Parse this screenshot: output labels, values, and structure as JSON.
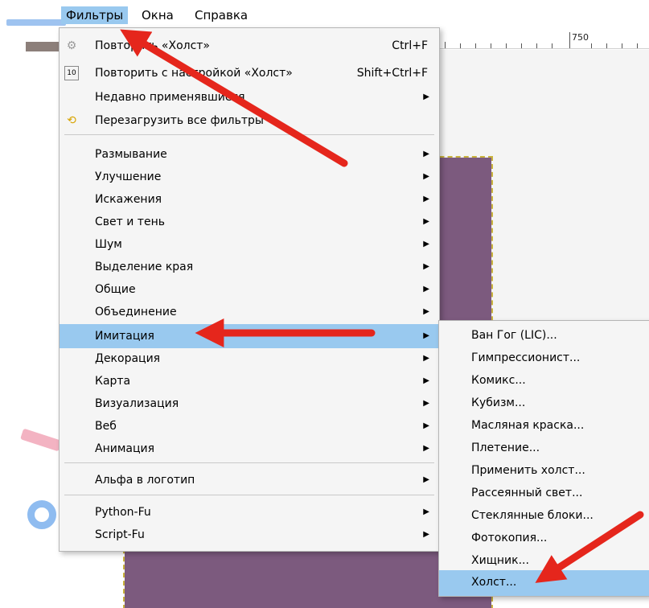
{
  "menubar": {
    "filters": "Фильтры",
    "windows": "Окна",
    "help": "Справка"
  },
  "ruler": {
    "label": "750"
  },
  "filters_menu": {
    "items": [
      {
        "icon": "repeat-filter-icon",
        "label": "Повторить «Холст»",
        "shortcut": "Ctrl+F"
      },
      {
        "icon": "reshow-filter-icon",
        "label": "Повторить с настройкой «Холст»",
        "shortcut": "Shift+Ctrl+F"
      },
      {
        "icon": "",
        "label": "Недавно применявшиеся",
        "shortcut": ""
      },
      {
        "icon": "reset-filters-icon",
        "label": "Перезагрузить все фильтры",
        "shortcut": ""
      },
      {
        "label": "Размывание"
      },
      {
        "label": "Улучшение"
      },
      {
        "label": "Искажения"
      },
      {
        "label": "Свет и тень"
      },
      {
        "label": "Шум"
      },
      {
        "label": "Выделение края"
      },
      {
        "label": "Общие"
      },
      {
        "label": "Объединение"
      },
      {
        "label": "Имитация"
      },
      {
        "label": "Декорация"
      },
      {
        "label": "Карта"
      },
      {
        "label": "Визуализация"
      },
      {
        "label": "Веб"
      },
      {
        "label": "Анимация"
      },
      {
        "label": "Альфа в логотип"
      },
      {
        "label": "Python-Fu"
      },
      {
        "label": "Script-Fu"
      }
    ]
  },
  "imitation_submenu": {
    "items": [
      "Ван Гог (LIC)...",
      "Гимпрессионист...",
      "Комикс...",
      "Кубизм...",
      "Масляная краска...",
      "Плетение...",
      "Применить холст...",
      "Рассеянный свет...",
      "Стеклянные блоки...",
      "Фотокопия...",
      "Хищник...",
      "Холст..."
    ]
  },
  "colors": {
    "highlight": "#99c9ef",
    "annotation_arrow": "#e5261c",
    "image_fill": "#7c5a7e"
  }
}
